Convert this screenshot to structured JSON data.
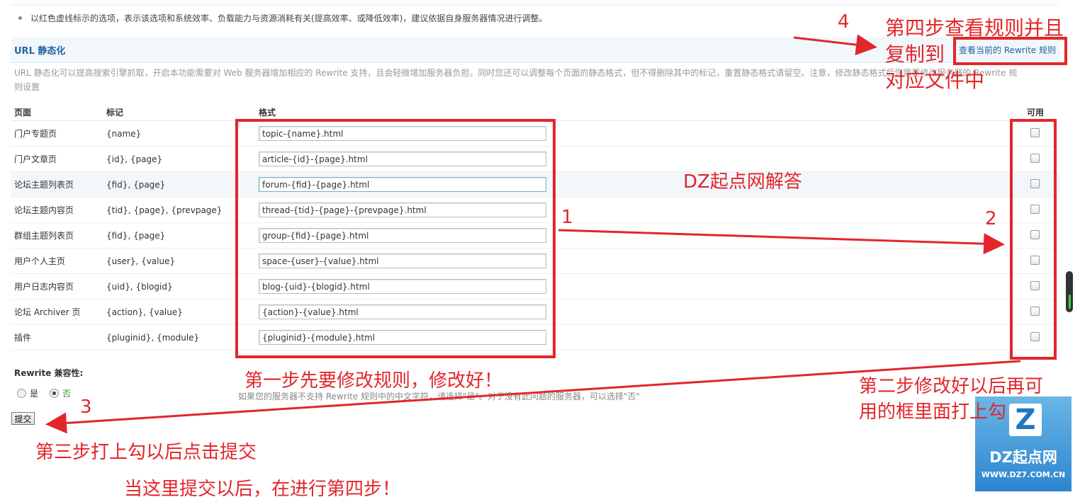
{
  "tip": "以红色虚线标示的选项，表示该选项和系统效率、负载能力与资源消耗有关(提高效率、或降低效率)，建议依据自身服务器情况进行调整。",
  "section": {
    "title": "URL 静态化",
    "view_rules_link": "查看当前的 Rewrite 规则",
    "description": "URL 静态化可以提高搜索引擎抓取，开启本功能需要对 Web 服务器增加相应的 Rewrite 支持，且会轻微增加服务器负担。同时您还可以调整每个页面的静态格式，但不得删除其中的标记，重置静态格式请留空。注意，修改静态格式后您需要修改服务器的 Rewrite 规则设置"
  },
  "table": {
    "headers": {
      "page": "页面",
      "marks": "标记",
      "format": "格式",
      "enabled": "可用"
    },
    "rows": [
      {
        "page": "门户专题页",
        "marks": "{name}",
        "format": "topic-{name}.html",
        "checked": false
      },
      {
        "page": "门户文章页",
        "marks": "{id}, {page}",
        "format": "article-{id}-{page}.html",
        "checked": false
      },
      {
        "page": "论坛主题列表页",
        "marks": "{fid}, {page}",
        "format": "forum-{fid}-{page}.html",
        "checked": false
      },
      {
        "page": "论坛主题内容页",
        "marks": "{tid}, {page}, {prevpage}",
        "format": "thread-{tid}-{page}-{prevpage}.html",
        "checked": false
      },
      {
        "page": "群组主题列表页",
        "marks": "{fid}, {page}",
        "format": "group-{fid}-{page}.html",
        "checked": false
      },
      {
        "page": "用户个人主页",
        "marks": "{user}, {value}",
        "format": "space-{user}-{value}.html",
        "checked": false
      },
      {
        "page": "用户日志内容页",
        "marks": "{uid}, {blogid}",
        "format": "blog-{uid}-{blogid}.html",
        "checked": false
      },
      {
        "page": "论坛 Archiver 页",
        "marks": "{action}, {value}",
        "format": "{action}-{value}.html",
        "checked": false
      },
      {
        "page": "插件",
        "marks": "{pluginid}, {module}",
        "format": "{pluginid}-{module}.html",
        "checked": false
      }
    ]
  },
  "compat": {
    "title": "Rewrite 兼容性:",
    "yes": "是",
    "no": "否",
    "selected": "否",
    "note": "如果您的服务器不支持 Rewrite 规则中的中文字符，请选择\"是\"。对于没有此问题的服务器，可以选择\"否\""
  },
  "submit_label": "提交",
  "annotations": {
    "num1": "1",
    "num2": "2",
    "num3": "3",
    "num4": "4",
    "step4_line1": "第四步查看规则并且",
    "step4_line2": "复制到",
    "step4_line3": "对应文件中",
    "watermark": "DZ起点网解答",
    "step1": "第一步先要修改规则，修改好！",
    "step2_line1": "第二步修改好以后再可",
    "step2_line2": "用的框里面打上勾",
    "step3": "第三步打上勾以后点击提交",
    "step3_note": "当这里提交以后，在进行第四步！",
    "color": "#e2262b"
  },
  "logo": {
    "mark": "Z",
    "name": "DZ起点网",
    "url": "WWW.DZ7.COM.CN"
  }
}
